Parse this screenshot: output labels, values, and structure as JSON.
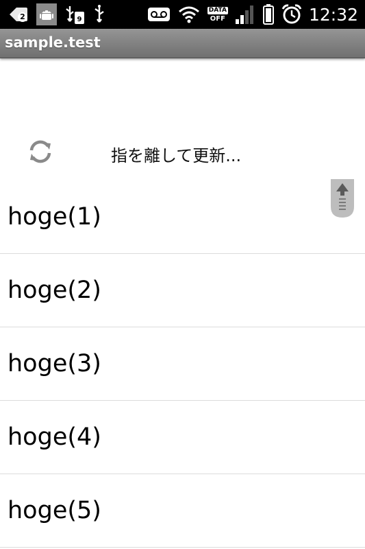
{
  "status_bar": {
    "notification_count": "2",
    "data_indicator_top": "DATA",
    "data_indicator_bottom": "OFF",
    "time": "12:32",
    "icons": [
      "back-badge-icon",
      "android-debug-icon",
      "usb-sd-icon",
      "usb-icon",
      "voicemail-icon",
      "wifi-icon",
      "data-off-icon",
      "signal-icon",
      "battery-icon",
      "alarm-icon"
    ]
  },
  "title_bar": {
    "title": "sample.test"
  },
  "refresh_header": {
    "icon": "refresh-icon",
    "label": "指を離して更新..."
  },
  "list": {
    "items": [
      {
        "label": "hoge(1)"
      },
      {
        "label": "hoge(2)"
      },
      {
        "label": "hoge(3)"
      },
      {
        "label": "hoge(4)"
      },
      {
        "label": "hoge(5)"
      }
    ]
  },
  "scroll_thumb": {
    "icon": "up-arrow-scroll-icon"
  }
}
